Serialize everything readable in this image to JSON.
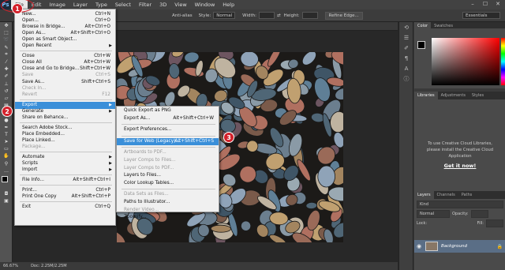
{
  "app": {
    "logo": "Ps"
  },
  "menubar": [
    "File",
    "Edit",
    "Image",
    "Layer",
    "Type",
    "Select",
    "Filter",
    "3D",
    "View",
    "Window",
    "Help"
  ],
  "window_controls": [
    "–",
    "☐",
    "✕"
  ],
  "options": {
    "anti_alias": "Anti-alias",
    "style_label": "Style:",
    "style_value": "Normal",
    "width_label": "Width:",
    "height_label": "Height:",
    "refine_edge": "Refine Edge...",
    "workspace": "Essentials"
  },
  "file_menu": [
    {
      "label": "New...",
      "shortcut": "Ctrl+N",
      "enabled": true
    },
    {
      "label": "Open...",
      "shortcut": "Ctrl+O",
      "enabled": true
    },
    {
      "label": "Browse in Bridge...",
      "shortcut": "Alt+Ctrl+O",
      "enabled": true
    },
    {
      "label": "Open As...",
      "shortcut": "Alt+Shift+Ctrl+O",
      "enabled": true
    },
    {
      "label": "Open as Smart Object...",
      "shortcut": "",
      "enabled": true
    },
    {
      "label": "Open Recent",
      "shortcut": "",
      "enabled": true,
      "submenu": true
    },
    {
      "separator": true
    },
    {
      "label": "Close",
      "shortcut": "Ctrl+W",
      "enabled": true
    },
    {
      "label": "Close All",
      "shortcut": "Alt+Ctrl+W",
      "enabled": true
    },
    {
      "label": "Close and Go to Bridge...",
      "shortcut": "Shift+Ctrl+W",
      "enabled": true
    },
    {
      "label": "Save",
      "shortcut": "Ctrl+S",
      "enabled": false
    },
    {
      "label": "Save As...",
      "shortcut": "Shift+Ctrl+S",
      "enabled": true
    },
    {
      "label": "Check In...",
      "shortcut": "",
      "enabled": false
    },
    {
      "label": "Revert",
      "shortcut": "F12",
      "enabled": false
    },
    {
      "separator": true
    },
    {
      "label": "Export",
      "shortcut": "",
      "enabled": true,
      "submenu": true,
      "highlighted": true
    },
    {
      "label": "Generate",
      "shortcut": "",
      "enabled": true,
      "submenu": true
    },
    {
      "label": "Share on Behance...",
      "shortcut": "",
      "enabled": true
    },
    {
      "separator": true
    },
    {
      "label": "Search Adobe Stock...",
      "shortcut": "",
      "enabled": true
    },
    {
      "label": "Place Embedded...",
      "shortcut": "",
      "enabled": true
    },
    {
      "label": "Place Linked...",
      "shortcut": "",
      "enabled": true
    },
    {
      "label": "Package...",
      "shortcut": "",
      "enabled": false
    },
    {
      "separator": true
    },
    {
      "label": "Automate",
      "shortcut": "",
      "enabled": true,
      "submenu": true
    },
    {
      "label": "Scripts",
      "shortcut": "",
      "enabled": true,
      "submenu": true
    },
    {
      "label": "Import",
      "shortcut": "",
      "enabled": true,
      "submenu": true
    },
    {
      "separator": true
    },
    {
      "label": "File Info...",
      "shortcut": "Alt+Shift+Ctrl+I",
      "enabled": true
    },
    {
      "separator": true
    },
    {
      "label": "Print...",
      "shortcut": "Ctrl+P",
      "enabled": true
    },
    {
      "label": "Print One Copy",
      "shortcut": "Alt+Shift+Ctrl+P",
      "enabled": true
    },
    {
      "separator": true
    },
    {
      "label": "Exit",
      "shortcut": "Ctrl+Q",
      "enabled": true
    }
  ],
  "export_menu": [
    {
      "label": "Quick Export as PNG",
      "shortcut": "",
      "enabled": true
    },
    {
      "label": "Export As...",
      "shortcut": "Alt+Shift+Ctrl+W",
      "enabled": true
    },
    {
      "separator": true
    },
    {
      "label": "Export Preferences...",
      "shortcut": "",
      "enabled": true
    },
    {
      "separator": true
    },
    {
      "label": "Save for Web (Legacy)...",
      "shortcut": "Alt+Shift+Ctrl+S",
      "enabled": true,
      "highlighted": true
    },
    {
      "separator": true
    },
    {
      "label": "Artboards to PDF...",
      "shortcut": "",
      "enabled": false
    },
    {
      "label": "Layer Comps to Files...",
      "shortcut": "",
      "enabled": false
    },
    {
      "label": "Layer Comps to PDF...",
      "shortcut": "",
      "enabled": false
    },
    {
      "label": "Layers to Files...",
      "shortcut": "",
      "enabled": true
    },
    {
      "label": "Color Lookup Tables...",
      "shortcut": "",
      "enabled": true
    },
    {
      "separator": true
    },
    {
      "label": "Data Sets as Files...",
      "shortcut": "",
      "enabled": false
    },
    {
      "label": "Paths to Illustrator...",
      "shortcut": "",
      "enabled": true
    },
    {
      "label": "Render Video...",
      "shortcut": "",
      "enabled": false
    },
    {
      "label": "Zoomify...",
      "shortcut": "",
      "enabled": true
    }
  ],
  "annotations": [
    "1",
    "2",
    "3"
  ],
  "color_panel": {
    "tabs": [
      "Color",
      "Swatches"
    ]
  },
  "libraries_panel": {
    "tabs": [
      "Libraries",
      "Adjustments",
      "Styles"
    ],
    "message": "To use Creative Cloud Libraries, please install the Creative Cloud Application",
    "cta": "Get it now!"
  },
  "layers_panel": {
    "tabs": [
      "Layers",
      "Channels",
      "Paths"
    ],
    "filter": "Kind",
    "mode": "Normal",
    "opacity_label": "Opacity:",
    "fill_label": "Fill:",
    "lock_label": "Lock:",
    "layer_name": "Background"
  },
  "status": {
    "zoom": "66.67%",
    "doc": "Doc: 2.25M/2.25M"
  },
  "colors": {
    "accent": "#3a8fd9",
    "annotation": "#d3202a",
    "layer_selected": "#5a6e86"
  }
}
